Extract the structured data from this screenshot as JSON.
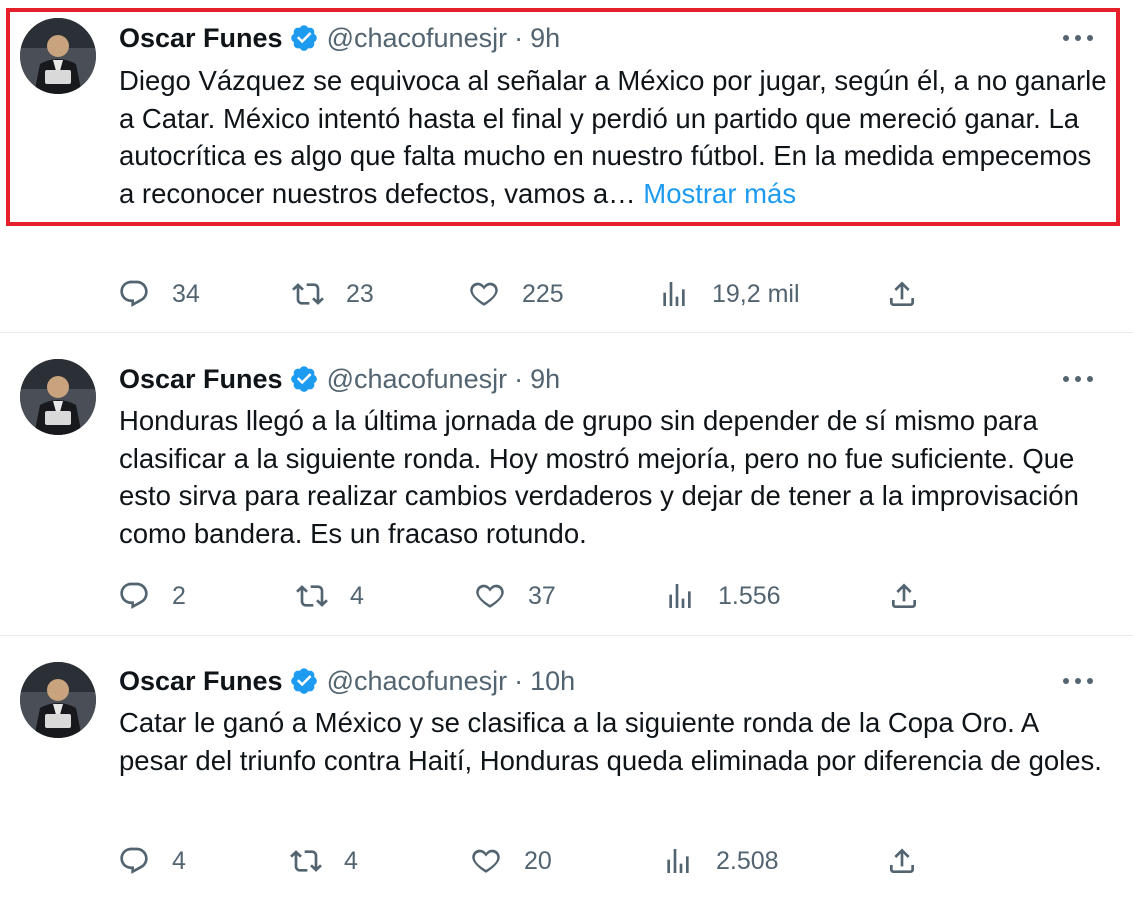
{
  "tweets": [
    {
      "author_name": "Oscar Funes",
      "handle": "@chacofunesjr",
      "separator": "·",
      "time": "9h",
      "text": "Diego Vázquez se equivoca al señalar a México por jugar, según él, a no ganarle a Catar. México intentó hasta el final y perdió un partido que mereció ganar. La autocrítica es algo que falta mucho en nuestro fútbol. En la medida empecemos a reconocer nuestros defectos, vamos a… ",
      "show_more": "Mostrar más",
      "replies": "34",
      "retweets": "23",
      "likes": "225",
      "views": "19,2 mil"
    },
    {
      "author_name": "Oscar Funes",
      "handle": "@chacofunesjr",
      "separator": "·",
      "time": "9h",
      "text": "Honduras llegó a la última jornada de grupo sin depender de sí mismo para clasificar a la siguiente ronda. Hoy mostró mejoría, pero no fue suficiente. Que esto sirva para realizar cambios verdaderos y dejar de tener a la improvisación como bandera. Es un fracaso rotundo.",
      "replies": "2",
      "retweets": "4",
      "likes": "37",
      "views": "1.556"
    },
    {
      "author_name": "Oscar Funes",
      "handle": "@chacofunesjr",
      "separator": "·",
      "time": "10h",
      "text": "Catar le ganó a México y se clasifica a la siguiente ronda de la Copa Oro. A pesar del triunfo contra Haití, Honduras queda eliminada por diferencia de goles.",
      "replies": "4",
      "retweets": "4",
      "likes": "20",
      "views": "2.508"
    }
  ],
  "icons": {
    "verified": "verified-badge-icon",
    "reply": "reply-icon",
    "retweet": "retweet-icon",
    "like": "heart-icon",
    "views": "views-chart-icon",
    "share": "share-icon",
    "more": "more-options-icon"
  },
  "colors": {
    "text": "#0f1419",
    "secondary": "#536471",
    "accent": "#1d9bf0",
    "highlight_border": "#e5202a",
    "separator": "#e7e9ea"
  }
}
